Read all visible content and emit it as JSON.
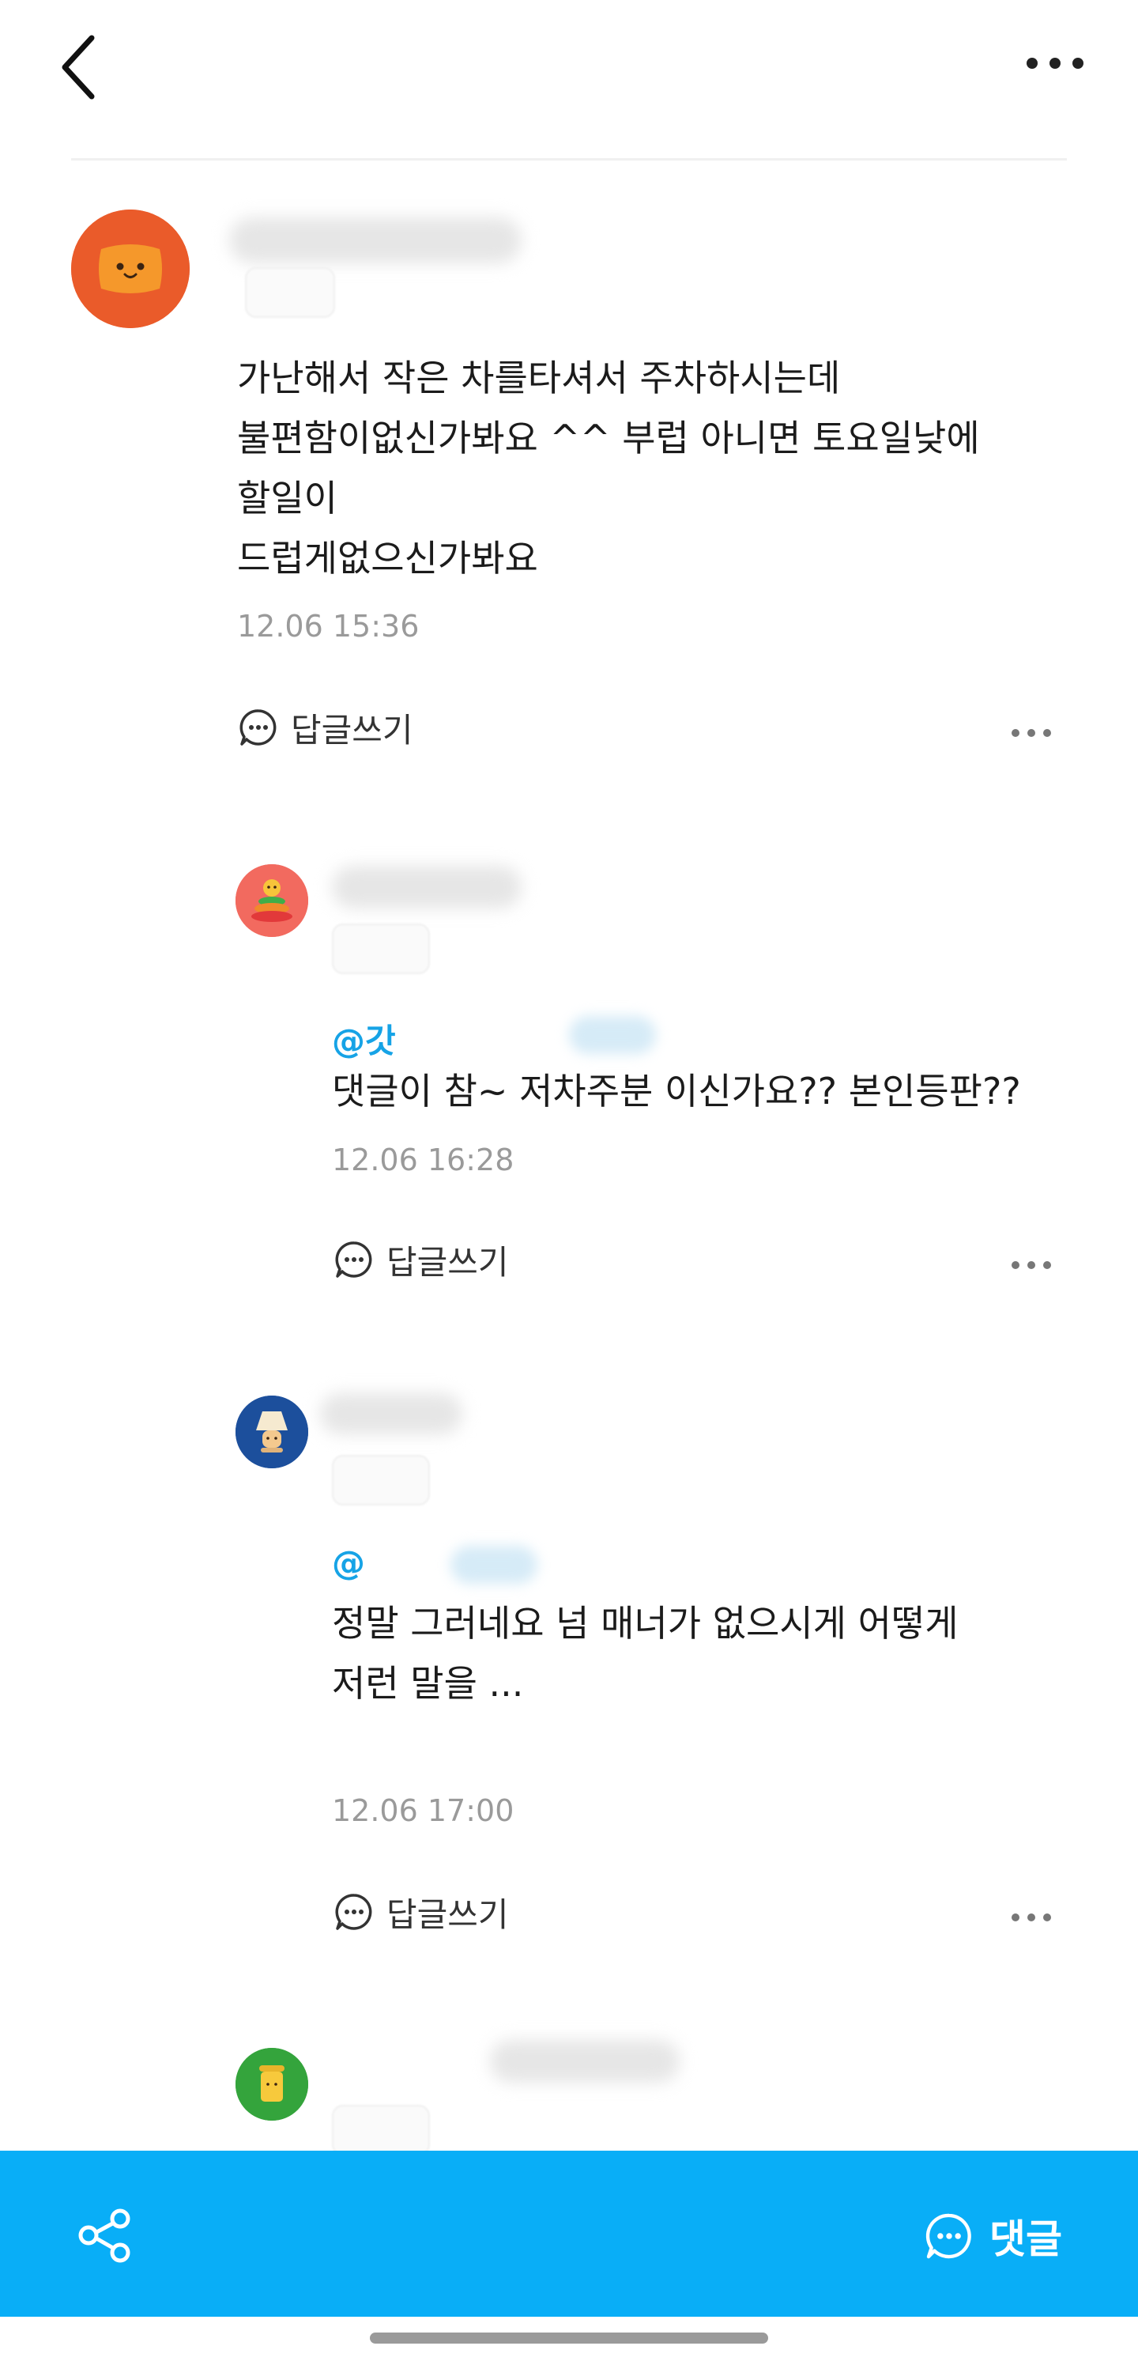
{
  "comments": [
    {
      "text_lines": [
        "가난해서 작은 차를타셔서 주차하시는데",
        "불편함이없신가봐요 ^^ 부럽 아니면 토요일낮에",
        "할일이",
        "드럽게없으신가봐요"
      ],
      "timestamp": "12.06 15:36",
      "reply_label": "답글쓰기"
    },
    {
      "mention": "@갓",
      "text_lines": [
        "댓글이 참~ 저차주분 이신가요?? 본인등판??"
      ],
      "timestamp": "12.06 16:28",
      "reply_label": "답글쓰기"
    },
    {
      "mention": "@",
      "text_lines": [
        "정말 그러네요 넘 매너가 없으시게 어떻게",
        "저런 말을 ..."
      ],
      "timestamp": "12.06 17:00",
      "reply_label": "답글쓰기"
    }
  ],
  "bottom_bar": {
    "comment_label": "댓글",
    "color": "#09aef7"
  },
  "icons": [
    "back-arrow-icon",
    "more-dots-icon",
    "chat-bubble-icon",
    "share-icon"
  ]
}
